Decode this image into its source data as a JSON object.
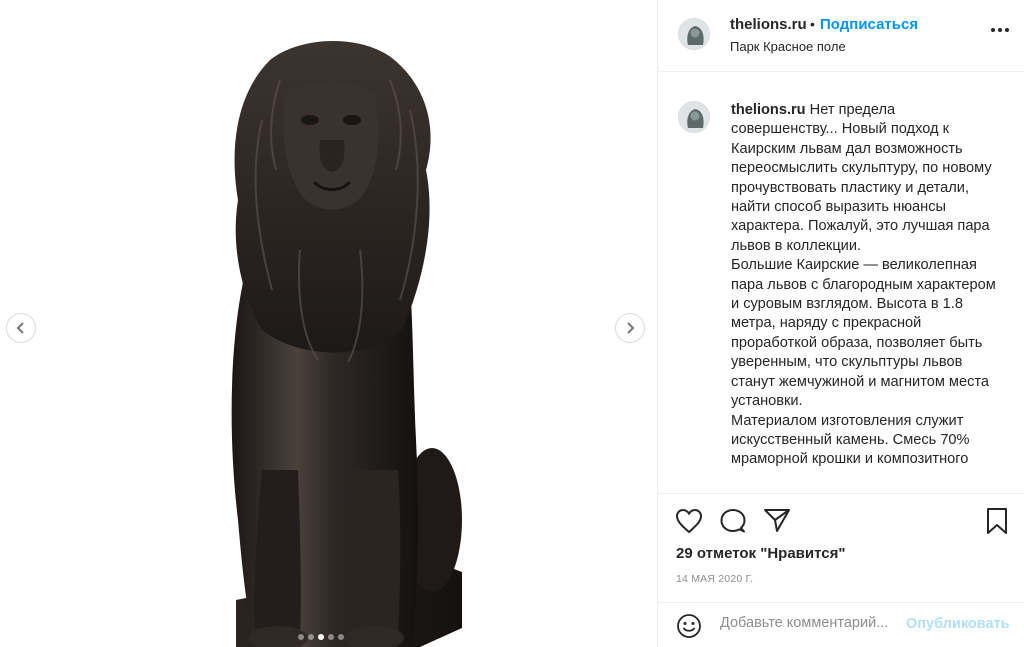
{
  "post": {
    "username": "thelions.ru",
    "separator": "•",
    "follow_label": "Подписаться",
    "location": "Парк Красное поле",
    "caption_text": "Нет предела совершенству... Новый подход к Каирским львам дал возможность переосмыслить скульптуру, по новому прочувствовать пластику и детали, найти способ выразить нюансы характера. Пожалуй, это лучшая пара львов в коллекции.\nБольшие Каирские — великолепная пара львов с благородным характером и суровым взглядом. Высота в 1.8 метра, наряду с прекрасной проработкой образа, позволяет быть уверенным, что скульптуры львов станут жемчужиной и магнитом места установки.\nМатериалом изготовления служит искусственный камень. Смесь 70% мраморной крошки и композитного",
    "likes": "29 отметок \"Нравится\"",
    "date": "14 МАЯ 2020 Г.",
    "comment_placeholder": "Добавьте комментарий...",
    "publish_label": "Опубликовать"
  },
  "carousel": {
    "slide_count": 5,
    "active_slide": 3
  },
  "colors": {
    "accent": "#0095f6",
    "publish_disabled": "#b2dffc",
    "text": "#262626",
    "muted": "#8e8e8e",
    "divider": "#efefef",
    "bronze_dark": "#1e1a18",
    "bronze_mid": "#3b3430",
    "bronze_light": "#6a5e56"
  },
  "icons": [
    "chevron-left-icon",
    "chevron-right-icon",
    "more-icon",
    "heart-icon",
    "comment-icon",
    "share-icon",
    "bookmark-icon",
    "emoji-icon"
  ]
}
